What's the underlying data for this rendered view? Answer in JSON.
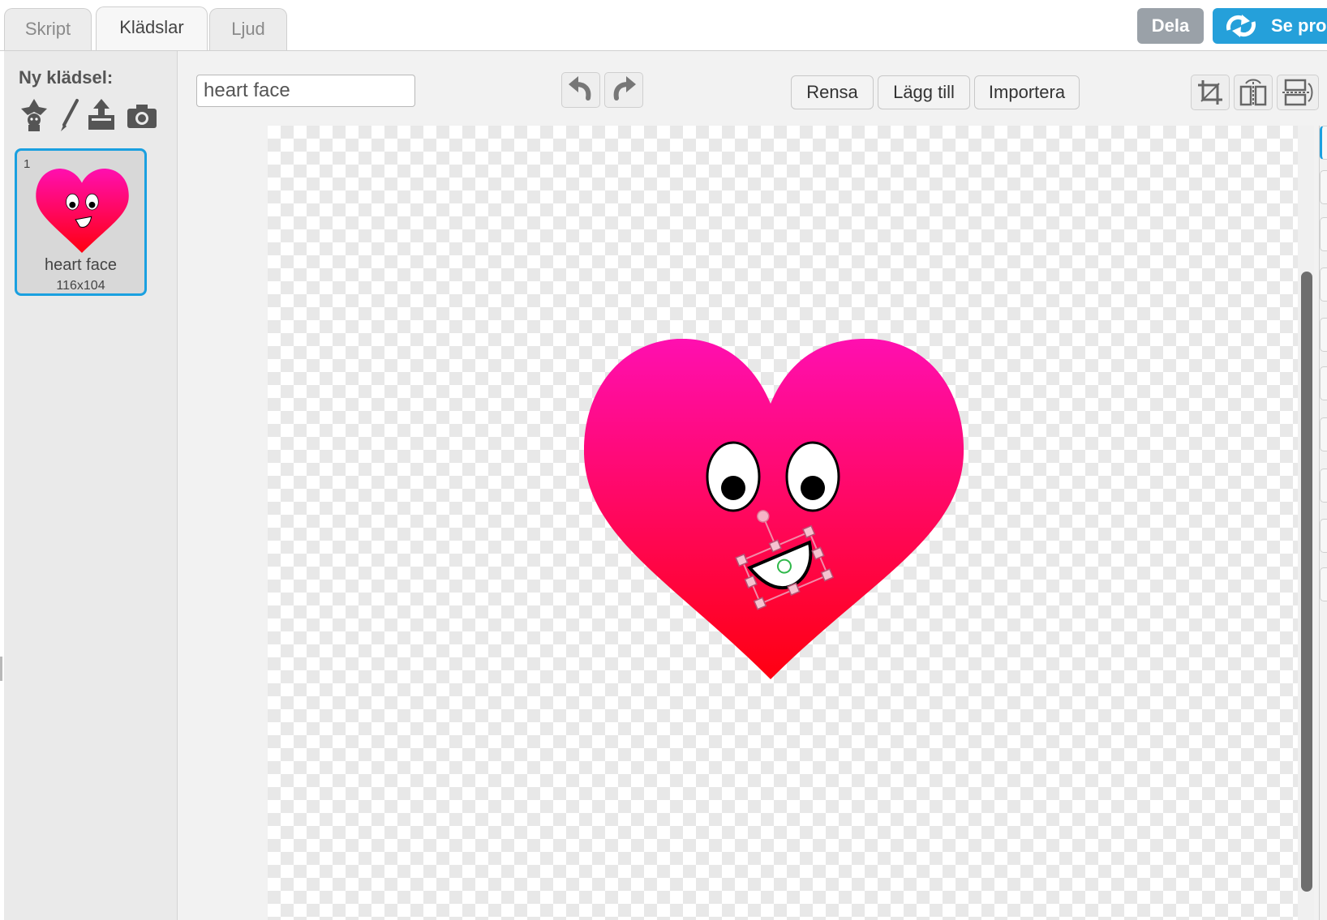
{
  "tabs": [
    {
      "label": "Skript",
      "active": false
    },
    {
      "label": "Klädslar",
      "active": true
    },
    {
      "label": "Ljud",
      "active": false
    }
  ],
  "header": {
    "share_label": "Dela",
    "see_project_label": "Se pro"
  },
  "costume_pane": {
    "title": "Ny klädsel:",
    "new_costume_icons": [
      "choose-from-library-icon",
      "paint-brush-icon",
      "upload-icon",
      "camera-icon"
    ],
    "costumes": [
      {
        "number": "1",
        "name": "heart face",
        "size": "116x104",
        "selected": true
      }
    ]
  },
  "editor": {
    "costume_name_value": "heart face",
    "undo_icon": "undo-icon",
    "redo_icon": "redo-icon",
    "clear_label": "Rensa",
    "add_label": "Lägg till",
    "import_label": "Importera",
    "tool_icons": [
      "crop-icon",
      "flip-horizontal-icon",
      "flip-vertical-icon"
    ]
  },
  "colors": {
    "accent": "#25a0da",
    "share_button": "#9aa1a8",
    "selection_border": "#1aa0e0",
    "heart_top": "#ff0fb0",
    "heart_bottom": "#ff0010"
  }
}
